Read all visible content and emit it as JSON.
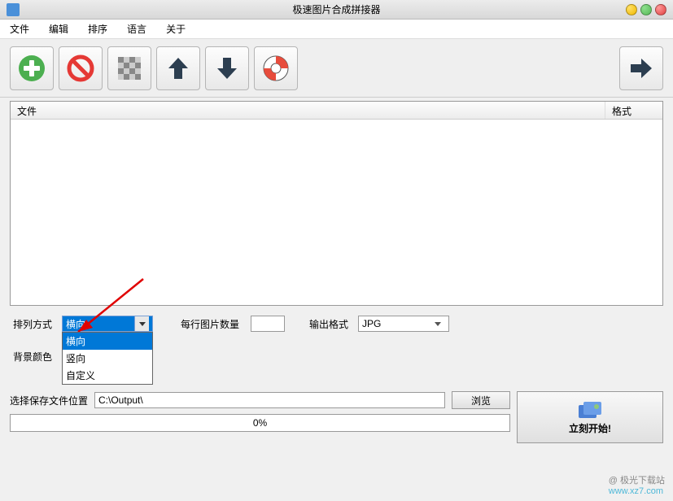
{
  "window": {
    "title": "极速图片合成拼接器"
  },
  "menu": {
    "file": "文件",
    "edit": "编辑",
    "sort": "排序",
    "language": "语言",
    "about": "关于"
  },
  "fileList": {
    "col_file": "文件",
    "col_format": "格式"
  },
  "options": {
    "arrange_label": "排列方式",
    "arrange_value": "横向",
    "arrange_options": [
      "横向",
      "竖向",
      "自定义"
    ],
    "per_row_label": "每行图片数量",
    "per_row_value": "",
    "output_format_label": "输出格式",
    "output_format_value": "JPG",
    "bg_color_label": "背景颜色"
  },
  "bottom": {
    "save_label": "选择保存文件位置",
    "save_path": "C:\\Output\\",
    "browse_label": "浏览",
    "progress_text": "0%",
    "start_label": "立刻开始!"
  },
  "watermark": {
    "line1": "@ 极光下载站",
    "line2": "www.xz7.com"
  }
}
